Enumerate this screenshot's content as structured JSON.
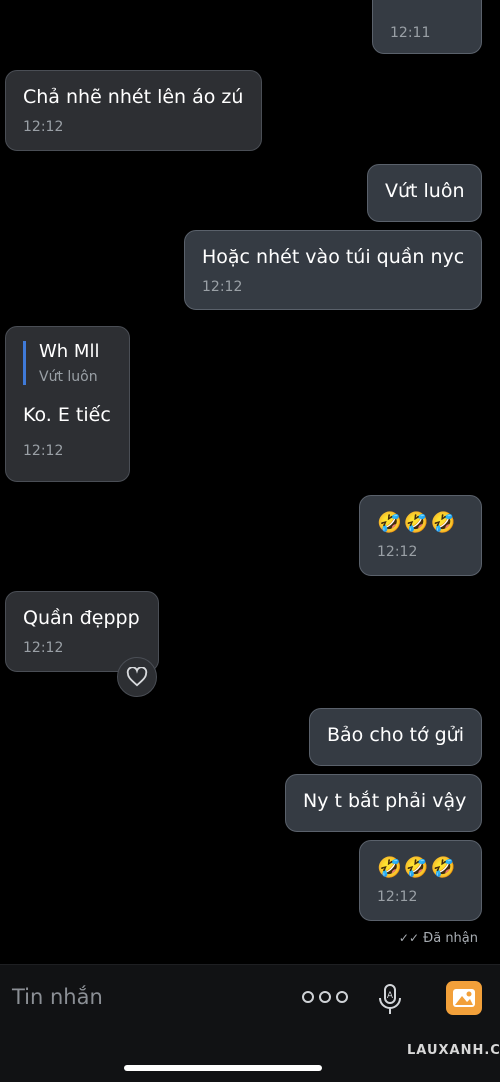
{
  "chat": {
    "partial_top": {
      "time": "12:11"
    },
    "messages": [
      {
        "sender": "received",
        "text": "Chả nhẽ nhét lên áo zú",
        "time": "12:12"
      },
      {
        "sender": "sent",
        "text": "Vứt luôn",
        "time": ""
      },
      {
        "sender": "sent",
        "text": "Hoặc nhét vào túi quần nyc",
        "time": "12:12"
      },
      {
        "sender": "received",
        "reply": {
          "name": "Wh Mll",
          "text": "Vứt luôn"
        },
        "text": "Ko. E tiếc",
        "time": "12:12"
      },
      {
        "sender": "sent",
        "emoji": "🤣🤣🤣",
        "time": "12:12"
      },
      {
        "sender": "received",
        "text": "Quần đẹppp",
        "time": "12:12",
        "reaction": "heart"
      },
      {
        "sender": "sent",
        "text": "Bảo cho tớ gửi",
        "time": ""
      },
      {
        "sender": "sent",
        "text": "Ny t bắt phải vậy",
        "time": ""
      },
      {
        "sender": "sent",
        "emoji": "🤣🤣🤣",
        "time": "12:12"
      }
    ],
    "status": "Đã nhận"
  },
  "composer": {
    "placeholder": "Tin nhắn"
  },
  "watermark": "LAUXANH.CC",
  "colors": {
    "background": "#000000",
    "bubble_received": "#2d2f33",
    "bubble_sent": "#353b43",
    "reply_accent": "#3f7ad8",
    "image_button": "#f2a03a"
  },
  "icons": [
    "heart-icon",
    "more-icon",
    "mic-icon",
    "image-icon",
    "check-icon"
  ]
}
